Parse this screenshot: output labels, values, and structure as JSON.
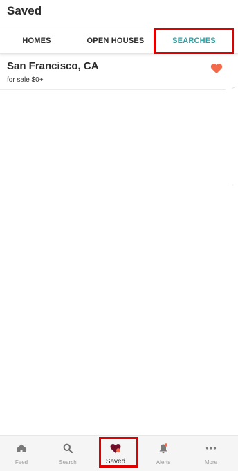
{
  "header": {
    "title": "Saved"
  },
  "tabs": [
    {
      "label": "HOMES",
      "active": false
    },
    {
      "label": "OPEN HOUSES",
      "active": false
    },
    {
      "label": "SEARCHES",
      "active": true
    }
  ],
  "saved_searches": [
    {
      "title": "San Francisco, CA",
      "subtitle": "for sale $0+",
      "favorited": true
    }
  ],
  "bottom_nav": [
    {
      "label": "Feed",
      "icon": "home-icon"
    },
    {
      "label": "Search",
      "icon": "search-icon"
    },
    {
      "label": "Saved",
      "icon": "heart-icon",
      "active": true
    },
    {
      "label": "Alerts",
      "icon": "bell-icon"
    },
    {
      "label": "More",
      "icon": "more-icon"
    }
  ],
  "colors": {
    "accent": "#2aa1a5",
    "heart": "#f26a4a",
    "highlight": "#e00000",
    "saved_icon": "#6b0f2a"
  }
}
